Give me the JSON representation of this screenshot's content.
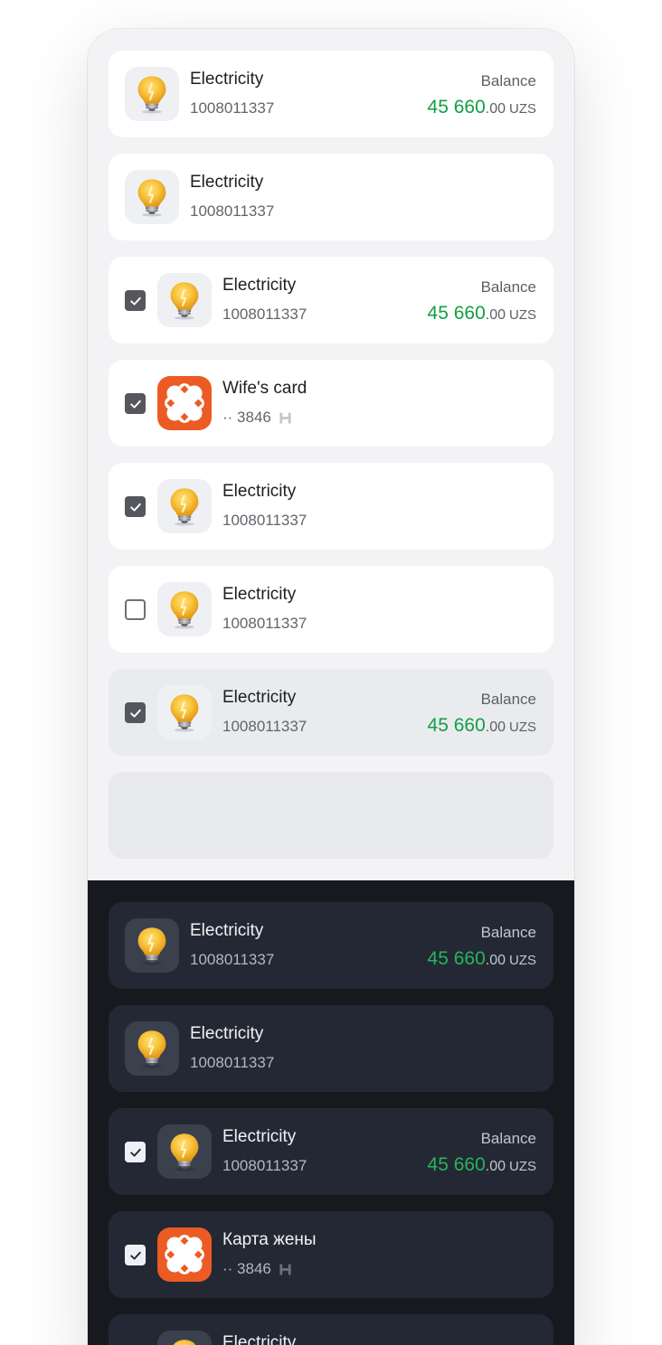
{
  "light": {
    "rows": [
      {
        "title": "Electricity",
        "subtitle": "1008011337",
        "balance_label": "Balance",
        "balance_int": "45 660",
        "balance_dec": ".00",
        "currency": "UZS"
      },
      {
        "title": "Electricity",
        "subtitle": "1008011337"
      },
      {
        "title": "Electricity",
        "subtitle": "1008011337",
        "balance_label": "Balance",
        "balance_int": "45 660",
        "balance_dec": ".00",
        "currency": "UZS",
        "checked": true
      },
      {
        "title": "Wife's card",
        "subtitle": "·· 3846",
        "checked": true
      },
      {
        "title": "Electricity",
        "subtitle": "1008011337",
        "checked": true
      },
      {
        "title": "Electricity",
        "subtitle": "1008011337",
        "checked": false
      },
      {
        "title": "Electricity",
        "subtitle": "1008011337",
        "balance_label": "Balance",
        "balance_int": "45 660",
        "balance_dec": ".00",
        "currency": "UZS",
        "checked": true
      }
    ]
  },
  "dark": {
    "rows": [
      {
        "title": "Electricity",
        "subtitle": "1008011337",
        "balance_label": "Balance",
        "balance_int": "45 660",
        "balance_dec": ".00",
        "currency": "UZS"
      },
      {
        "title": "Electricity",
        "subtitle": "1008011337"
      },
      {
        "title": "Electricity",
        "subtitle": "1008011337",
        "balance_label": "Balance",
        "balance_int": "45 660",
        "balance_dec": ".00",
        "currency": "UZS",
        "checked": true
      },
      {
        "title": "Карта жены",
        "subtitle": "·· 3846",
        "checked": true
      },
      {
        "title": "Electricity"
      }
    ]
  },
  "icons": {
    "service": "lightbulb-icon",
    "card": "humo-card-icon",
    "pay_system": "humo-logo-icon",
    "check": "checkmark-icon"
  },
  "colors": {
    "balance_green_light": "#11a042",
    "balance_green_dark": "#26b55a",
    "card_orange": "#ec5b24",
    "dark_background": "#17191f",
    "dark_row": "#232834",
    "light_background": "#f3f3f5"
  }
}
